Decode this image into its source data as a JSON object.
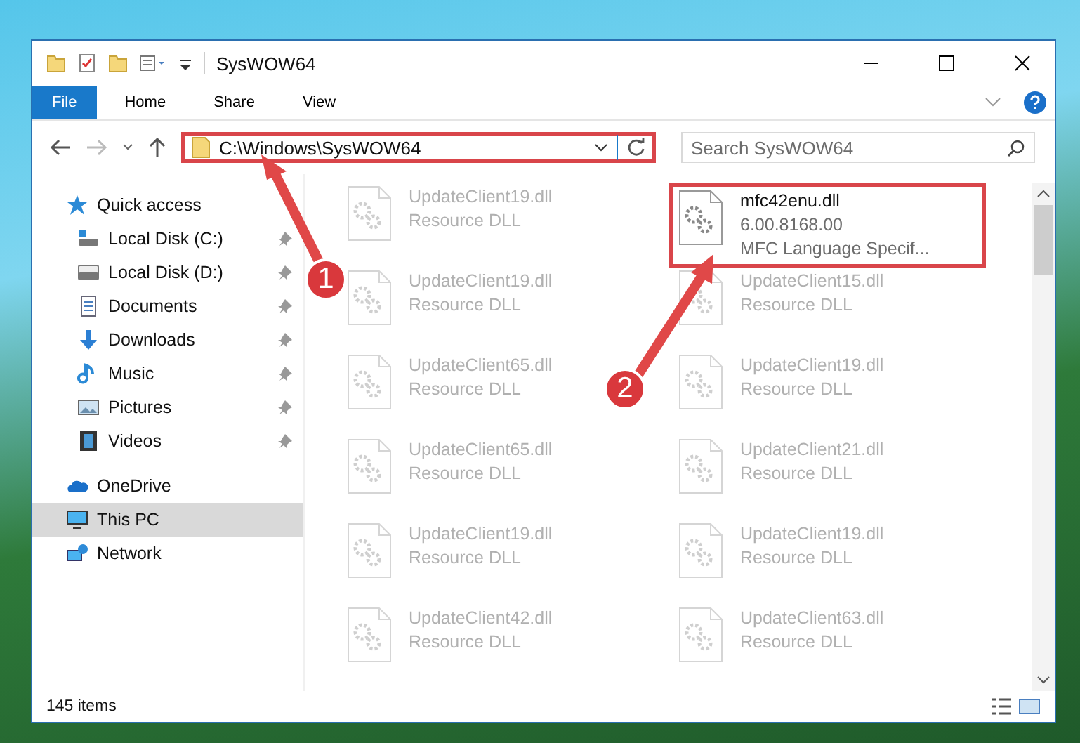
{
  "window": {
    "title": "SysWOW64"
  },
  "ribbon": {
    "tabs": [
      {
        "label": "File",
        "selected": true
      },
      {
        "label": "Home",
        "selected": false
      },
      {
        "label": "Share",
        "selected": false
      },
      {
        "label": "View",
        "selected": false
      }
    ]
  },
  "address_bar": {
    "path": "C:\\Windows\\SysWOW64",
    "highlighted": true
  },
  "search": {
    "placeholder": "Search SysWOW64"
  },
  "sidebar": {
    "items": [
      {
        "label": "Quick access",
        "selected": false,
        "children": [
          {
            "label": "Local Disk (C:)",
            "selected": false,
            "pinned": true
          },
          {
            "label": "Local Disk (D:)",
            "selected": false,
            "pinned": true
          },
          {
            "label": "Documents",
            "selected": false,
            "pinned": true
          },
          {
            "label": "Downloads",
            "selected": false,
            "pinned": true
          },
          {
            "label": "Music",
            "selected": false,
            "pinned": true
          },
          {
            "label": "Pictures",
            "selected": false,
            "pinned": true
          },
          {
            "label": "Videos",
            "selected": false,
            "pinned": true
          }
        ]
      },
      {
        "label": "OneDrive",
        "selected": false
      },
      {
        "label": "This PC",
        "selected": true
      },
      {
        "label": "Network",
        "selected": false
      }
    ]
  },
  "files": [
    {
      "name": "UpdateClient19.dll",
      "lines": [
        "Resource DLL"
      ],
      "highlighted": false,
      "blurred": true
    },
    {
      "name": "mfc42enu.dll",
      "lines": [
        "6.00.8168.00",
        "MFC Language Specif..."
      ],
      "highlighted": true,
      "blurred": false
    },
    {
      "name": "UpdateClient19.dll",
      "lines": [
        "Resource DLL"
      ],
      "highlighted": false,
      "blurred": true
    },
    {
      "name": "UpdateClient15.dll",
      "lines": [
        "Resource DLL"
      ],
      "highlighted": false,
      "blurred": true
    },
    {
      "name": "UpdateClient65.dll",
      "lines": [
        "Resource DLL"
      ],
      "highlighted": false,
      "blurred": true
    },
    {
      "name": "UpdateClient19.dll",
      "lines": [
        "Resource DLL"
      ],
      "highlighted": false,
      "blurred": true
    },
    {
      "name": "UpdateClient65.dll",
      "lines": [
        "Resource DLL"
      ],
      "highlighted": false,
      "blurred": true
    },
    {
      "name": "UpdateClient21.dll",
      "lines": [
        "Resource DLL"
      ],
      "highlighted": false,
      "blurred": true
    },
    {
      "name": "UpdateClient19.dll",
      "lines": [
        "Resource DLL"
      ],
      "highlighted": false,
      "blurred": true
    },
    {
      "name": "UpdateClient19.dll",
      "lines": [
        "Resource DLL"
      ],
      "highlighted": false,
      "blurred": true
    },
    {
      "name": "UpdateClient42.dll",
      "lines": [
        "Resource DLL"
      ],
      "highlighted": false,
      "blurred": true
    },
    {
      "name": "UpdateClient63.dll",
      "lines": [
        "Resource DLL"
      ],
      "highlighted": false,
      "blurred": true
    }
  ],
  "status_bar": {
    "count": "145 items"
  },
  "callouts": [
    {
      "number": "1"
    },
    {
      "number": "2"
    }
  ]
}
